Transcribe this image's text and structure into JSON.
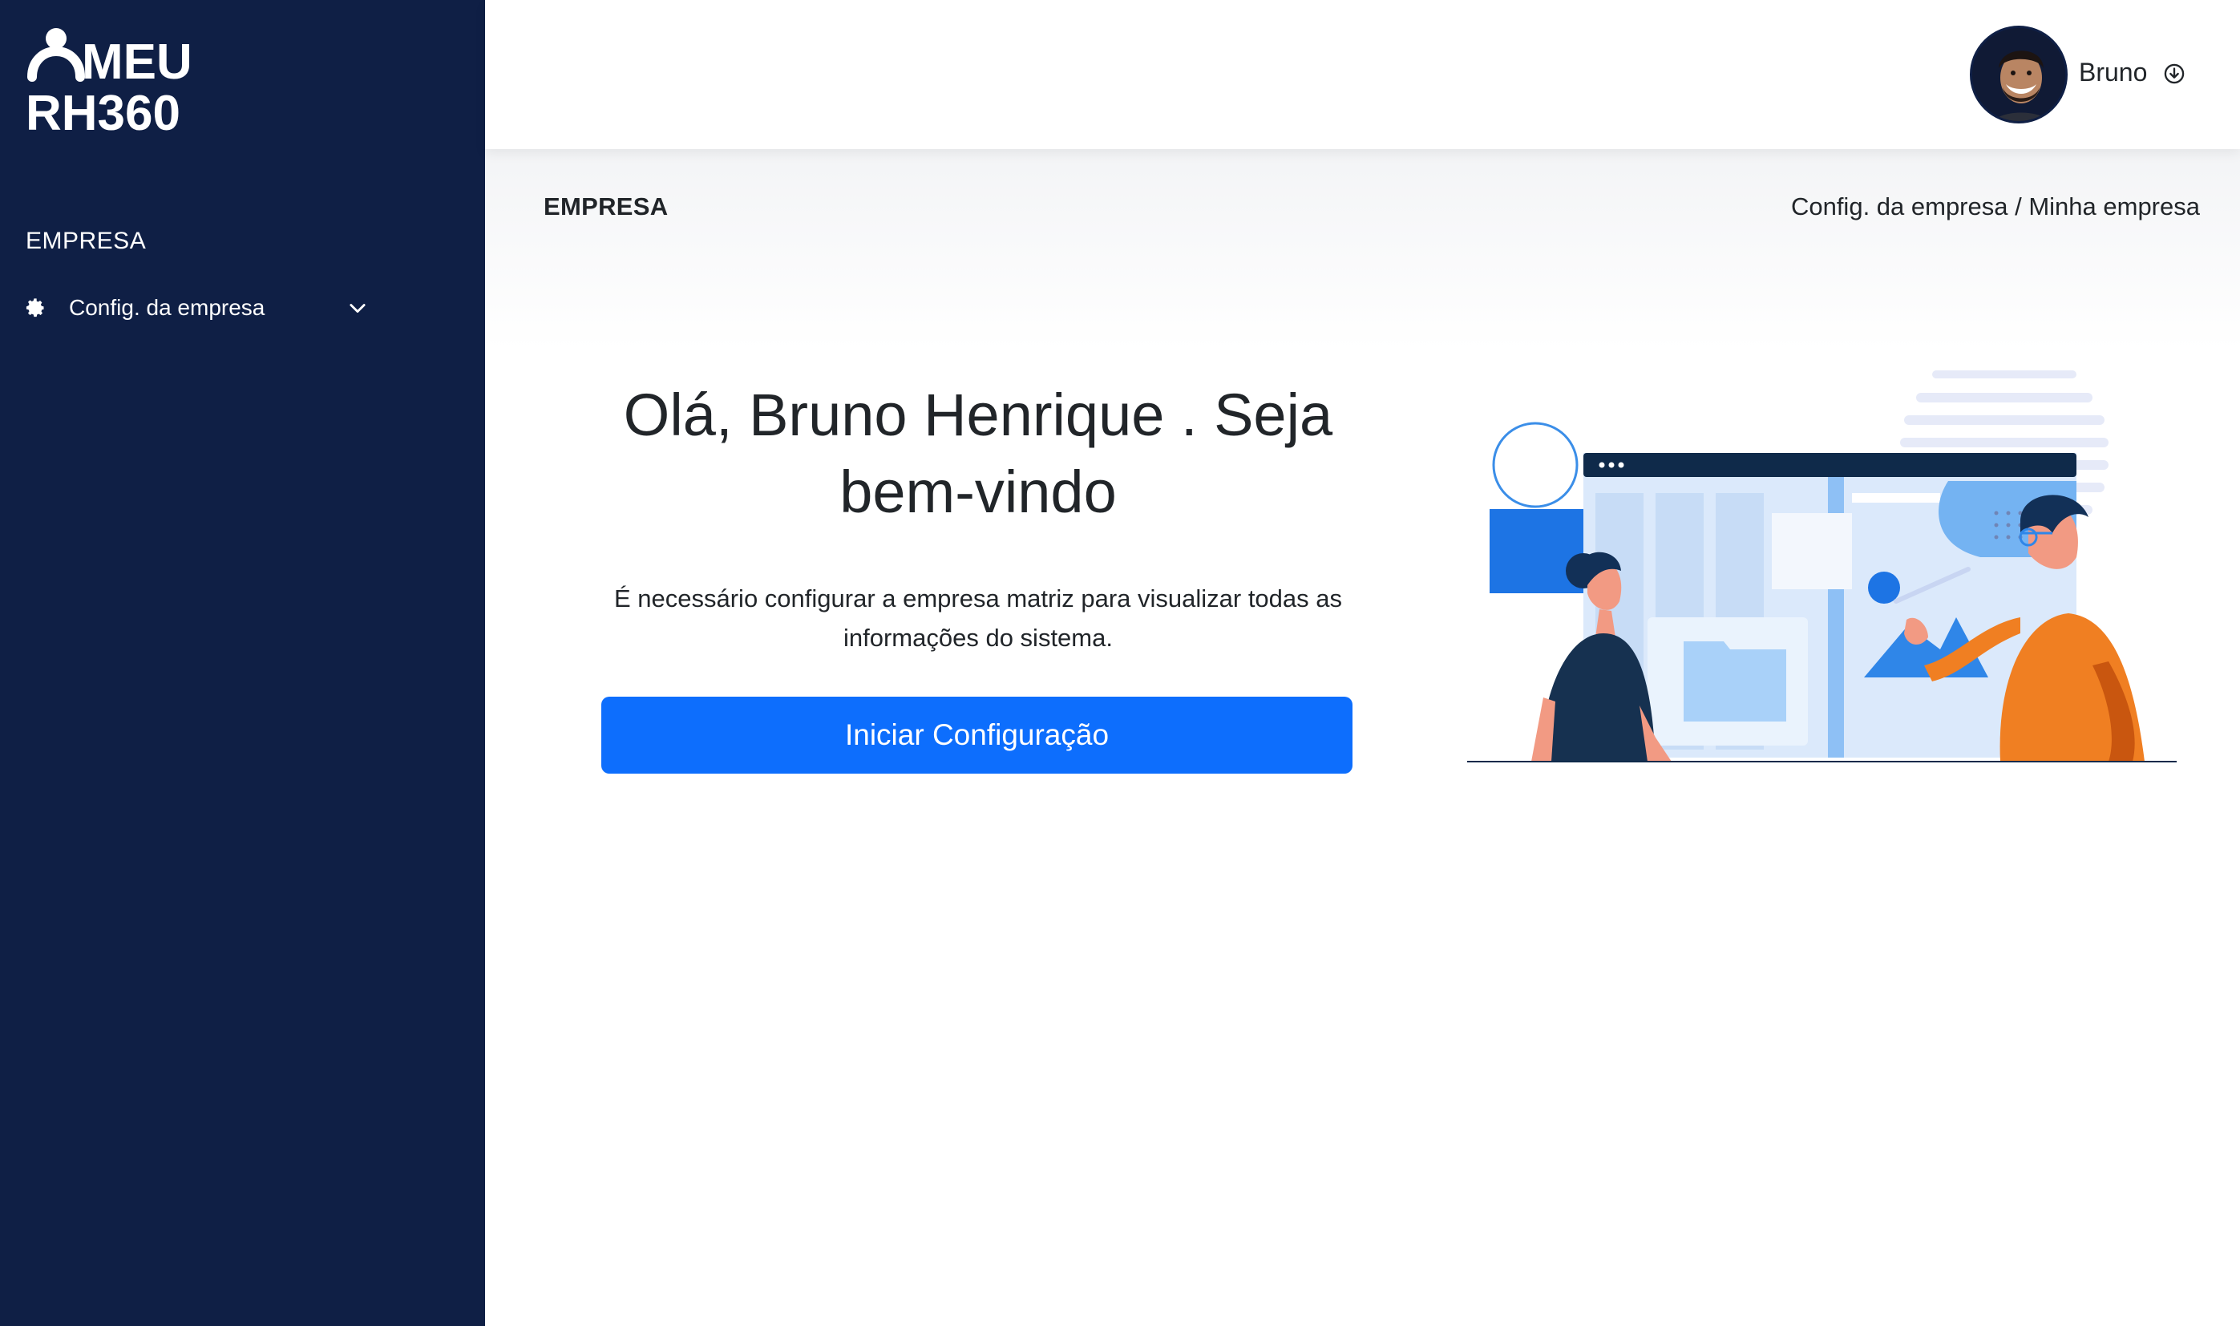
{
  "brand": {
    "line1": "MEU",
    "line2": "RH360"
  },
  "sidebar": {
    "section_title": "EMPRESA",
    "items": [
      {
        "label": "Config. da empresa",
        "icon": "gear-icon",
        "expand_icon": "chevron-down-icon"
      }
    ]
  },
  "topbar": {
    "user_name": "Bruno",
    "user_menu_icon": "circle-arrow-down-icon"
  },
  "header": {
    "title": "EMPRESA",
    "breadcrumb": "Config. da empresa / Minha empresa"
  },
  "welcome": {
    "title": "Olá, Bruno Henrique . Seja bem-vindo",
    "message": "É necessário configurar a empresa matriz para visualizar todas as informações do sistema.",
    "cta_label": "Iniciar Configuração"
  },
  "colors": {
    "sidebar_bg": "#0f1f45",
    "primary": "#0d6efd",
    "accent_orange": "#f07f22"
  }
}
